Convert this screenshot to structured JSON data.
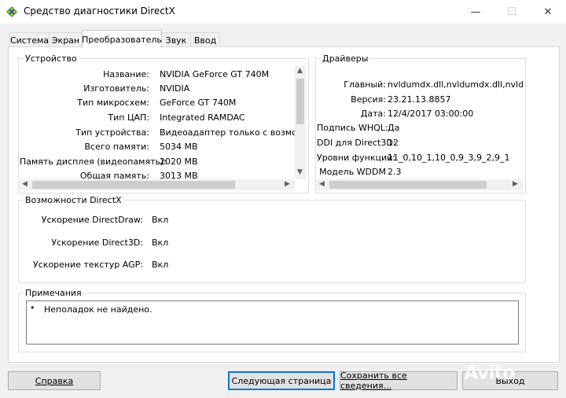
{
  "window": {
    "title": "Средство диагностики DirectX",
    "minimize_glyph": "—",
    "maximize_glyph": "☐",
    "close_glyph": "✕"
  },
  "tabs": [
    {
      "label": "Система"
    },
    {
      "label": "Экран"
    },
    {
      "label": "Преобразователь",
      "active": true
    },
    {
      "label": "Звук"
    },
    {
      "label": "Ввод"
    }
  ],
  "device": {
    "legend": "Устройство",
    "rows": [
      {
        "label": "Название:",
        "value": "NVIDIA GeForce GT 740M"
      },
      {
        "label": "Изготовитель:",
        "value": "NVIDIA"
      },
      {
        "label": "Тип микросхем:",
        "value": "GeForce GT 740M"
      },
      {
        "label": "Тип ЦАП:",
        "value": "Integrated RAMDAC"
      },
      {
        "label": "Тип устройства:",
        "value": "Видеоадаптер только с возможност"
      },
      {
        "label": "Всего памяти:",
        "value": "5034 MB"
      },
      {
        "label": "Память дисплея (видеопамять):",
        "value": "2020 MB"
      },
      {
        "label": "Общая память:",
        "value": "3013 MB"
      }
    ]
  },
  "drivers": {
    "legend": "Драйверы",
    "rows": [
      {
        "label": "Главный:",
        "value": "nvldumdx.dll,nvldumdx.dll,nvldumdx.d"
      },
      {
        "label": "Версия:",
        "value": "23.21.13.8857"
      },
      {
        "label": "Дата:",
        "value": "12/4/2017 03:00:00"
      },
      {
        "label": "Подпись WHQL:",
        "value": "Да"
      },
      {
        "label": "DDI для Direct3D:",
        "value": "12"
      },
      {
        "label": "Уровни функций:",
        "value": "11_0,10_1,10_0,9_3,9_2,9_1"
      },
      {
        "label": "Модель WDDM",
        "value": "2.3"
      }
    ]
  },
  "directx": {
    "legend": "Возможности DirectX",
    "rows": [
      {
        "label": "Ускорение DirectDraw:",
        "value": "Вкл"
      },
      {
        "label": "Ускорение Direct3D:",
        "value": "Вкл"
      },
      {
        "label": "Ускорение текстур AGP:",
        "value": "Вкл"
      }
    ]
  },
  "notes": {
    "legend": "Примечания",
    "items": [
      "Неполадок не найдено."
    ]
  },
  "buttons": {
    "help": "Справка",
    "next": "Следующая страница",
    "save": "Сохранить все сведения...",
    "exit": "Выход"
  },
  "watermark": "Avito",
  "colors": {
    "accent": "#0078d7",
    "icon_yellow": "#f2c500",
    "icon_green": "#3aa53a"
  }
}
